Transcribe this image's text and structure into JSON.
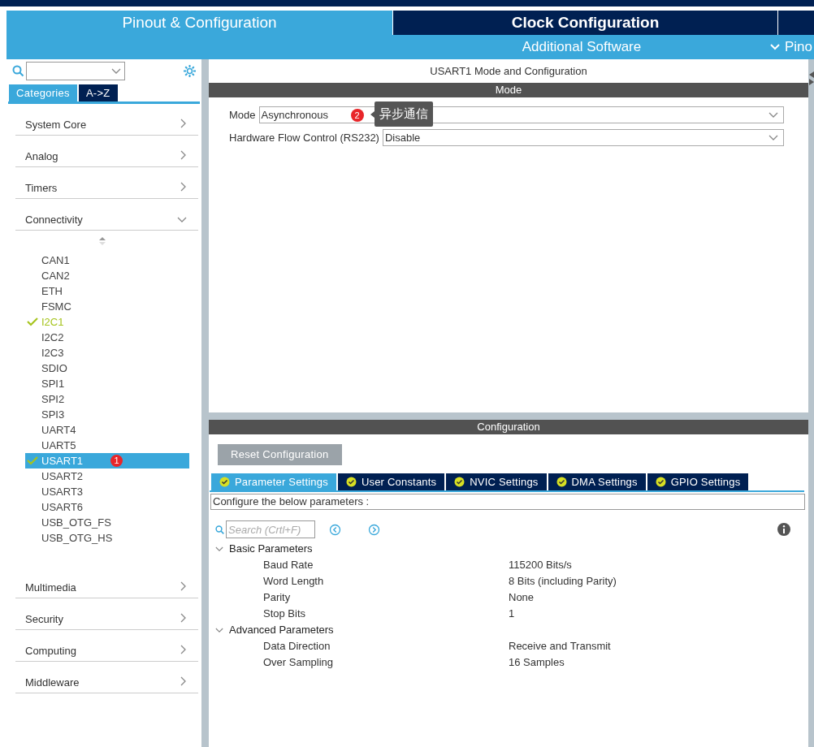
{
  "main_tabs": [
    {
      "label": "Pinout & Configuration",
      "selected": true
    },
    {
      "label": "Clock Configuration",
      "selected": false
    }
  ],
  "sub_bar": {
    "additional_software": "Additional Software",
    "pinout_menu": "Pino"
  },
  "sidebar": {
    "tabs": [
      {
        "label": "Categories",
        "selected": true
      },
      {
        "label": "A->Z",
        "selected": false
      }
    ],
    "categories": [
      {
        "label": "System Core",
        "expanded": false
      },
      {
        "label": "Analog",
        "expanded": false
      },
      {
        "label": "Timers",
        "expanded": false
      },
      {
        "label": "Connectivity",
        "expanded": true,
        "children": [
          {
            "label": "CAN1",
            "configured": false,
            "selected": false
          },
          {
            "label": "CAN2",
            "configured": false,
            "selected": false
          },
          {
            "label": "ETH",
            "configured": false,
            "selected": false
          },
          {
            "label": "FSMC",
            "configured": false,
            "selected": false
          },
          {
            "label": "I2C1",
            "configured": true,
            "selected": false
          },
          {
            "label": "I2C2",
            "configured": false,
            "selected": false
          },
          {
            "label": "I2C3",
            "configured": false,
            "selected": false
          },
          {
            "label": "SDIO",
            "configured": false,
            "selected": false
          },
          {
            "label": "SPI1",
            "configured": false,
            "selected": false
          },
          {
            "label": "SPI2",
            "configured": false,
            "selected": false
          },
          {
            "label": "SPI3",
            "configured": false,
            "selected": false
          },
          {
            "label": "UART4",
            "configured": false,
            "selected": false
          },
          {
            "label": "UART5",
            "configured": false,
            "selected": false
          },
          {
            "label": "USART1",
            "configured": true,
            "selected": true,
            "badge": "1"
          },
          {
            "label": "USART2",
            "configured": false,
            "selected": false
          },
          {
            "label": "USART3",
            "configured": false,
            "selected": false
          },
          {
            "label": "USART6",
            "configured": false,
            "selected": false
          },
          {
            "label": "USB_OTG_FS",
            "configured": false,
            "selected": false
          },
          {
            "label": "USB_OTG_HS",
            "configured": false,
            "selected": false
          }
        ]
      },
      {
        "label": "Multimedia",
        "expanded": false
      },
      {
        "label": "Security",
        "expanded": false
      },
      {
        "label": "Computing",
        "expanded": false
      },
      {
        "label": "Middleware",
        "expanded": false
      }
    ]
  },
  "panel_title": "USART1 Mode and Configuration",
  "mode_section": {
    "header": "Mode",
    "fields": [
      {
        "label": "Mode",
        "value": "Asynchronous",
        "badge": "2",
        "tooltip": "异步通信"
      },
      {
        "label": "Hardware Flow Control (RS232)",
        "value": "Disable"
      }
    ]
  },
  "config_section": {
    "header": "Configuration",
    "reset_button": "Reset Configuration",
    "tabs": [
      {
        "label": "Parameter Settings",
        "selected": true
      },
      {
        "label": "User Constants",
        "selected": false
      },
      {
        "label": "NVIC Settings",
        "selected": false
      },
      {
        "label": "DMA Settings",
        "selected": false
      },
      {
        "label": "GPIO Settings",
        "selected": false
      }
    ],
    "hint": "Configure the below parameters :",
    "search": {
      "placeholder": "Search (Crtl+F)"
    },
    "groups": [
      {
        "label": "Basic Parameters",
        "expanded": true,
        "children": [
          {
            "name": "Baud Rate",
            "value": "115200 Bits/s"
          },
          {
            "name": "Word Length",
            "value": "8 Bits (including Parity)"
          },
          {
            "name": "Parity",
            "value": "None"
          },
          {
            "name": "Stop Bits",
            "value": "1"
          }
        ]
      },
      {
        "label": "Advanced Parameters",
        "expanded": true,
        "children": [
          {
            "name": "Data Direction",
            "value": "Receive and Transmit"
          },
          {
            "name": "Over Sampling",
            "value": "16 Samples"
          }
        ]
      }
    ]
  }
}
